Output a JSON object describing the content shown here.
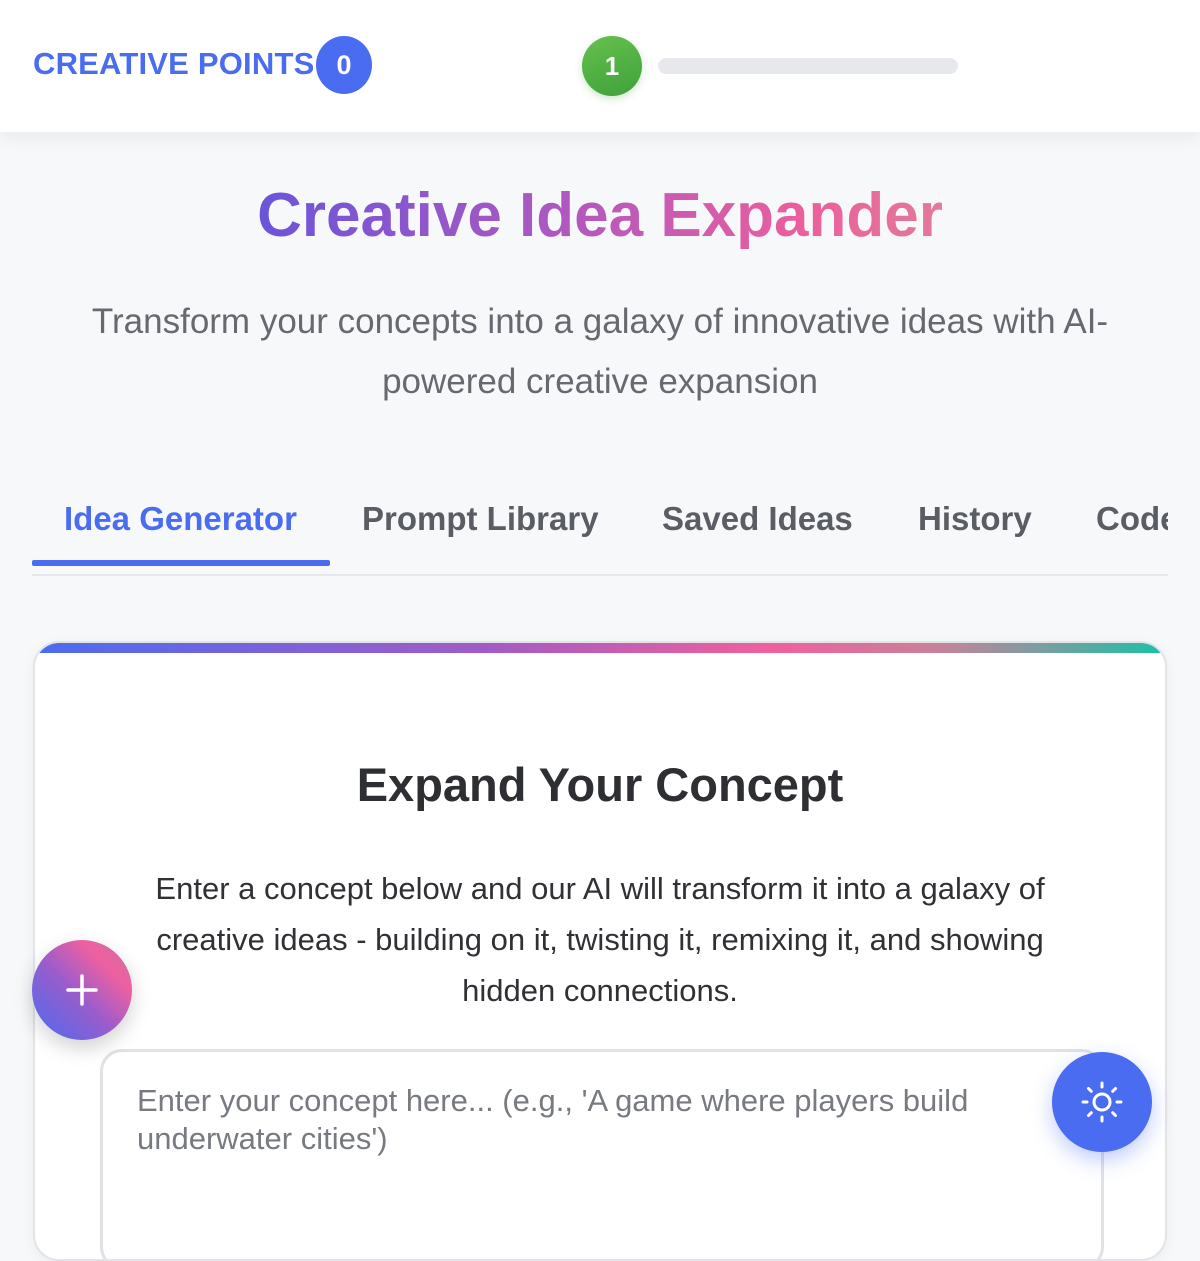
{
  "header": {
    "points_label": "CREATIVE POINTS",
    "points_value": "0",
    "level_value": "1",
    "level_progress": 0
  },
  "hero": {
    "title": "Creative Idea Expander",
    "subtitle": "Transform your concepts into a galaxy of innovative ideas with AI-powered creative expansion"
  },
  "tabs": [
    {
      "label": "Idea Generator",
      "active": true
    },
    {
      "label": "Prompt Library",
      "active": false
    },
    {
      "label": "Saved Ideas",
      "active": false
    },
    {
      "label": "History",
      "active": false
    },
    {
      "label": "Code",
      "active": false
    }
  ],
  "card": {
    "title": "Expand Your Concept",
    "description": "Enter a concept below and our AI will transform it into a galaxy of creative ideas - building on it, twisting it, remixing it, and showing hidden connections.",
    "input_placeholder": "Enter your concept here... (e.g., 'A game where players build underwater cities')",
    "input_value": ""
  },
  "fabs": {
    "add_icon": "plus-icon",
    "theme_icon": "sun-icon"
  },
  "colors": {
    "accent": "#4a6cf0",
    "level": "#4caf50",
    "title_gradient_start": "#6a55d8",
    "title_gradient_end": "#ec5f9c",
    "card_gradient_end": "#1cc0a8"
  }
}
